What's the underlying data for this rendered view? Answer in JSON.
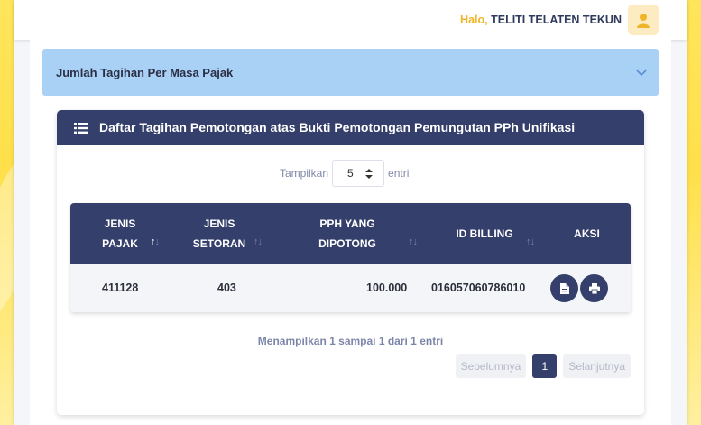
{
  "topbar": {
    "greeting_prefix": "Halo,",
    "user_name": "TELITI TELATEN TEKUN",
    "avatar_icon": "user-icon"
  },
  "accordion": {
    "title": "Jumlah Tagihan Per Masa Pajak",
    "icon": "chevron-down-icon"
  },
  "card": {
    "title": "Daftar Tagihan Pemotongan atas Bukti Pemotongan Pemungutan PPh Unifikasi",
    "icon": "list-icon"
  },
  "length_menu": {
    "before": "Tampilkan",
    "value": "5",
    "after": "entri"
  },
  "table": {
    "columns": [
      {
        "line1": "JENIS",
        "line2": "PAJAK"
      },
      {
        "line1": "JENIS",
        "line2": "SETORAN"
      },
      {
        "line1": "PPH YANG",
        "line2": "DIPOTONG"
      },
      {
        "line1": "ID BILLING",
        "line2": ""
      },
      {
        "line1": "AKSI",
        "line2": ""
      }
    ],
    "rows": [
      {
        "jenis_pajak": "411128",
        "jenis_setoran": "403",
        "pph_dipotong": "100.000",
        "id_billing": "016057060786010",
        "actions": [
          "document-icon",
          "print-icon"
        ]
      }
    ]
  },
  "info": "Menampilkan 1 sampai 1 dari 1 entri",
  "pagination": {
    "prev": "Sebelumnya",
    "current": "1",
    "next": "Selanjutnya"
  },
  "colors": {
    "navy": "#343f6b",
    "accordion": "#a9d0f5",
    "accent_yellow": "#f0b429"
  }
}
